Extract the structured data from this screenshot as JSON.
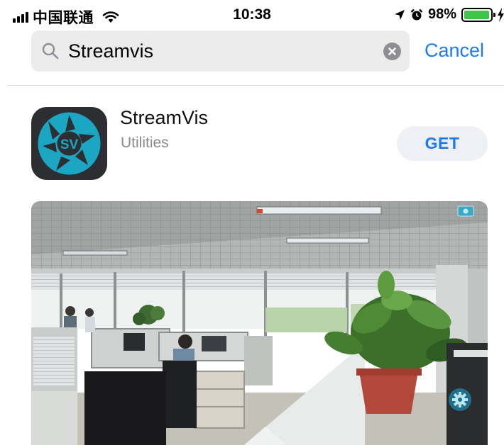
{
  "status_bar": {
    "carrier": "中国联通",
    "time": "10:38",
    "battery_percent": "98%",
    "battery_level": 0.98,
    "icons": [
      "signal-bars-icon",
      "wifi-icon",
      "location-arrow-icon",
      "alarm-clock-icon",
      "battery-icon",
      "charging-bolt-icon"
    ]
  },
  "search": {
    "value": "Streamvis",
    "icon": "magnifier-icon",
    "clear_icon": "clear-circle-icon",
    "cancel_label": "Cancel"
  },
  "result": {
    "app_name": "StreamVis",
    "category": "Utilities",
    "icon_text": "SV",
    "get_label": "GET"
  },
  "preview": {
    "icons": [
      "camera-badge-icon",
      "settings-gear-icon"
    ]
  },
  "colors": {
    "accent_blue": "#1a7bf5",
    "battery_green": "#3ec64b",
    "search_bg": "#ececed",
    "app_icon_bg": "#2d2e32",
    "app_icon_teal": "#1ba6c4"
  }
}
